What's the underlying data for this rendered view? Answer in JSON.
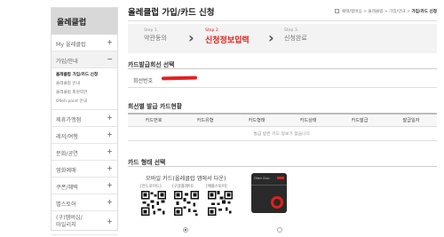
{
  "sidebar": {
    "title": "올레클럽",
    "items": [
      {
        "label": "My 올레클럽",
        "icon": "plus-icon"
      },
      {
        "label": "가입/안내",
        "icon": "minus-icon"
      },
      {
        "label": "제휴가맹점",
        "icon": "plus-icon"
      },
      {
        "label": "레저/여행",
        "icon": "plus-icon"
      },
      {
        "label": "문화/공연",
        "icon": "plus-icon"
      },
      {
        "label": "영화예매",
        "icon": "plus-icon"
      },
      {
        "label": "쿠폰/혜택",
        "icon": "plus-icon"
      },
      {
        "label": "별스토어",
        "icon": "plus-icon"
      },
      {
        "label": "(구)멤버십/",
        "label2": "마일리지",
        "icon": "plus-icon"
      }
    ],
    "subitems": [
      "올레클럽 가입/카드 신청",
      "올레클럽 안내",
      "올레클럽 회원약관",
      "Olleh point 안내"
    ]
  },
  "header": {
    "title": "올레클럽 가입/카드 신청",
    "breadcrumb": [
      "쉐택/멤버십",
      "올레클럽",
      "가입/안내",
      "가입/카드 신청"
    ]
  },
  "steps": [
    {
      "num": "Step 1.",
      "label": "약관동의"
    },
    {
      "num": "Step 2.",
      "label": "신청정보입력"
    },
    {
      "num": "Step 3.",
      "label": "신청완료"
    }
  ],
  "member_section": {
    "title": "카드발급회선 선택",
    "label": "회선번호",
    "value": ""
  },
  "card_status": {
    "title": "회선별 발급 카드현황",
    "columns": [
      "카드번호",
      "카드유형",
      "카드형태",
      "카드상태",
      "카드발급",
      "발급일자"
    ],
    "empty_message": "발급 받은 카드 정보가 없습니다."
  },
  "card_type": {
    "title": "카드 형태 선택",
    "mobile_title": "모바일 카드(올레클럽 앱에서 다운)",
    "qr_labels": [
      "[안드로이드]",
      "[구글플레이]",
      "[애플스토어]"
    ],
    "card_brand": "Olleh Club"
  },
  "colors": {
    "accent": "#e0201c"
  }
}
